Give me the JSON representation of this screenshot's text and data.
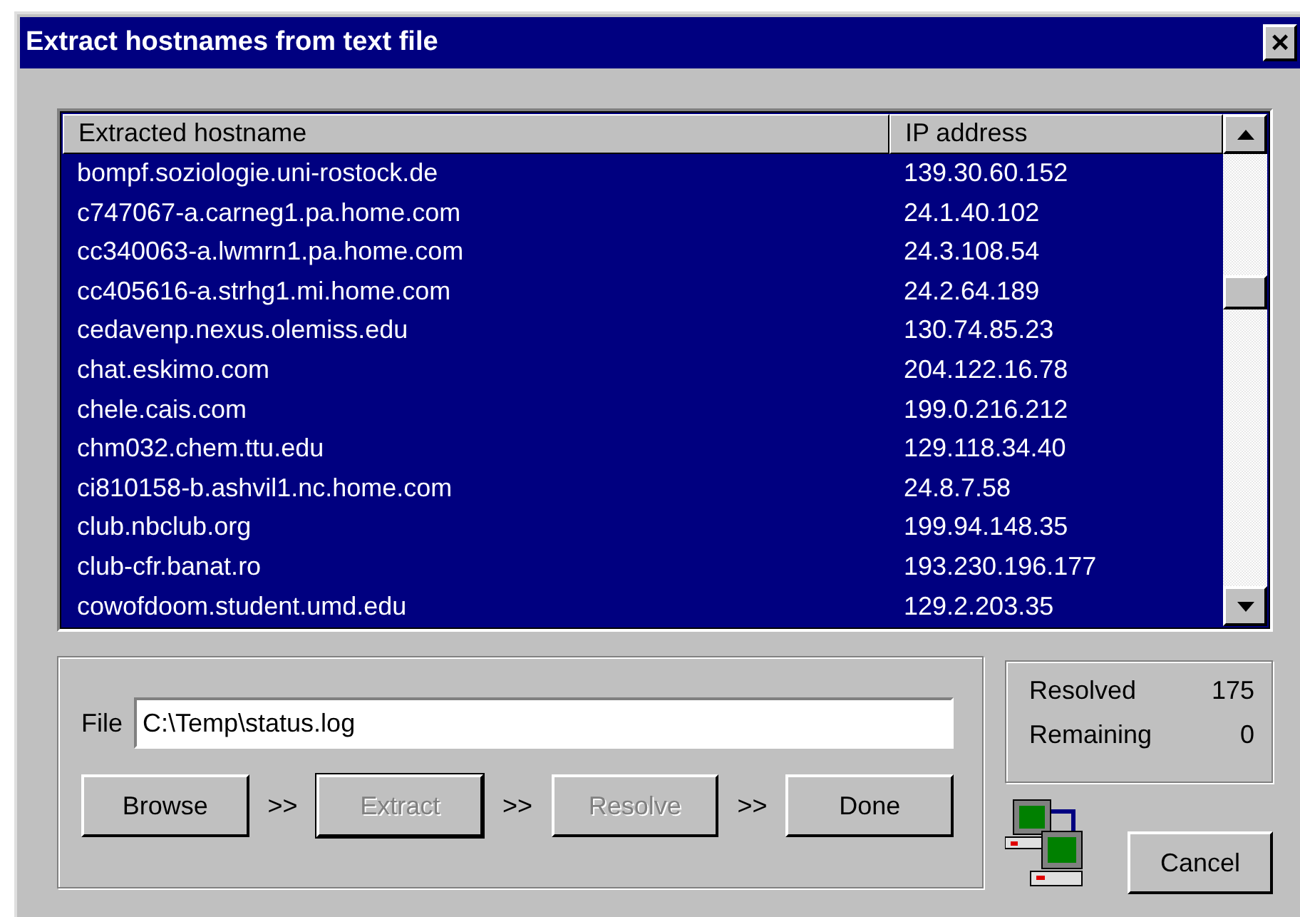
{
  "window": {
    "title": "Extract hostnames from text file",
    "close_label": "×"
  },
  "table": {
    "columns": [
      "Extracted hostname",
      "IP address"
    ],
    "rows": [
      {
        "hostname": "bompf.soziologie.uni-rostock.de",
        "ip": "139.30.60.152",
        "selected": true
      },
      {
        "hostname": "c747067-a.carneg1.pa.home.com",
        "ip": "24.1.40.102",
        "selected": true
      },
      {
        "hostname": "cc340063-a.lwmrn1.pa.home.com",
        "ip": "24.3.108.54",
        "selected": true
      },
      {
        "hostname": "cc405616-a.strhg1.mi.home.com",
        "ip": "24.2.64.189",
        "selected": true
      },
      {
        "hostname": "cedavenp.nexus.olemiss.edu",
        "ip": "130.74.85.23",
        "selected": true
      },
      {
        "hostname": "chat.eskimo.com",
        "ip": "204.122.16.78",
        "selected": true
      },
      {
        "hostname": "chele.cais.com",
        "ip": "199.0.216.212",
        "selected": true
      },
      {
        "hostname": "chm032.chem.ttu.edu",
        "ip": "129.118.34.40",
        "selected": true
      },
      {
        "hostname": "ci810158-b.ashvil1.nc.home.com",
        "ip": "24.8.7.58",
        "selected": true
      },
      {
        "hostname": "club.nbclub.org",
        "ip": "199.94.148.35",
        "selected": true
      },
      {
        "hostname": "club-cfr.banat.ro",
        "ip": "193.230.196.177",
        "selected": true
      },
      {
        "hostname": "cowofdoom.student.umd.edu",
        "ip": "129.2.203.35",
        "selected": true
      }
    ]
  },
  "file": {
    "label": "File",
    "value": "C:\\Temp\\status.log"
  },
  "steps": [
    {
      "label": "Browse",
      "disabled": false
    },
    {
      "label": "Extract",
      "disabled": true
    },
    {
      "label": "Resolve",
      "disabled": true
    },
    {
      "label": "Done",
      "disabled": false
    }
  ],
  "separator": ">>",
  "stats": [
    {
      "label": "Resolved",
      "value": "175"
    },
    {
      "label": "Remaining",
      "value": "0"
    }
  ],
  "cancel": "Cancel"
}
